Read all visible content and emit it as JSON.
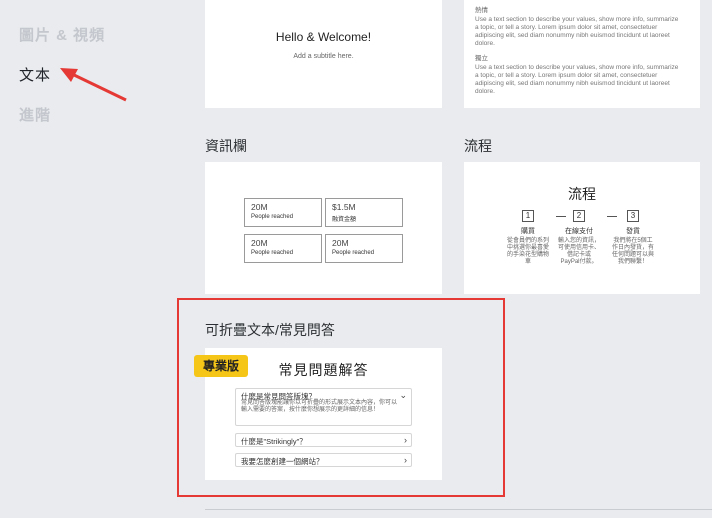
{
  "sidebar": {
    "items": [
      {
        "label": "圖片 & 視頻"
      },
      {
        "label": "文本"
      },
      {
        "label": "進階"
      }
    ]
  },
  "cards": {
    "welcome": {
      "title": "Hello & Welcome!",
      "subtitle": "Add a subtitle here."
    },
    "text": {
      "label1": "熱情",
      "body1": "Use a text section to describe your values, show more info, summarize a topic, or tell a story. Lorem ipsum dolor sit amet, consectetuer adipiscing elit, sed diam nonummy nibh euismod tincidunt ut laoreet dolore.",
      "label2": "獨立",
      "body2": "Use a text section to describe your values, show more info, summarize a topic, or tell a story. Lorem ipsum dolor sit amet, consectetuer adipiscing elit, sed diam nonummy nibh euismod tincidunt ut laoreet dolore."
    },
    "stats": {
      "section_title": "資訊欄",
      "items": [
        {
          "num": "20M",
          "label": "People reached"
        },
        {
          "num": "$1.5M",
          "label": "融資金額"
        },
        {
          "num": "20M",
          "label": "People reached"
        },
        {
          "num": "20M",
          "label": "People reached"
        }
      ]
    },
    "process": {
      "section_title": "流程",
      "title": "流程",
      "steps": [
        {
          "num": "1",
          "name": "購買",
          "desc": "從會員們的系列中挑選你最喜愛的手染花型購物車"
        },
        {
          "num": "2",
          "name": "在線支付",
          "desc": "輸入您的資訊，可使用信用卡、借記卡或PayPal付款。"
        },
        {
          "num": "3",
          "name": "發貨",
          "desc": "我們將在5個工作日內發貨，有任何問題可以與我們聯繫！"
        }
      ]
    },
    "faq": {
      "section_title": "可折疊文本/常見問答",
      "badge": "專業版",
      "title": "常見問題解答",
      "items": [
        {
          "q": "什麼是常見問答版塊？",
          "a": "常見問答版塊能讓你以可折疊的形式展示文本內容，你可以輸入需要的答案，按什麼你想展示的更詳細的信息！",
          "chev": "⌄"
        },
        {
          "q": "什麼是\"Strikingly\"？",
          "chev": "›"
        },
        {
          "q": "我要怎麼創建一個網站？",
          "chev": "›"
        }
      ]
    }
  },
  "colors": {
    "highlight": "#e53935",
    "badge": "#f5c518",
    "arrow": "#e53935"
  }
}
